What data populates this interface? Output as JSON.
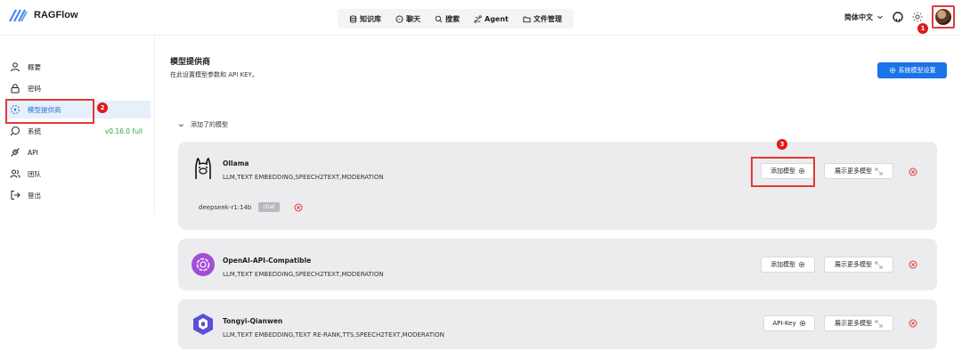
{
  "app": {
    "name": "RAGFlow"
  },
  "nav": [
    {
      "label": "知识库",
      "icon": "database-icon"
    },
    {
      "label": "聊天",
      "icon": "chat-icon"
    },
    {
      "label": "搜索",
      "icon": "search-icon"
    },
    {
      "label": "Agent",
      "icon": "agent-icon"
    },
    {
      "label": "文件管理",
      "icon": "folder-icon"
    }
  ],
  "header": {
    "language": "简体中文"
  },
  "sidebar": {
    "items": [
      {
        "label": "概要",
        "icon": "user-icon"
      },
      {
        "label": "密码",
        "icon": "lock-icon"
      },
      {
        "label": "模型提供商",
        "icon": "model-icon"
      },
      {
        "label": "系统",
        "icon": "system-icon"
      },
      {
        "label": "API",
        "icon": "api-icon"
      },
      {
        "label": "团队",
        "icon": "team-icon"
      },
      {
        "label": "登出",
        "icon": "logout-icon"
      }
    ],
    "version": "v0.16.0 full"
  },
  "main": {
    "title": "模型提供商",
    "subtitle": "在此设置模型参数和 API KEY。",
    "system_settings_button": "系统模型设置",
    "added_section": "添加了的模型"
  },
  "providers": [
    {
      "name": "Ollama",
      "tags": "LLM,TEXT EMBEDDING,SPEECH2TEXT,MODERATION",
      "primary_button": "添加模型",
      "secondary_button": "展示更多模型",
      "models": [
        {
          "name": "deepseek-r1:14b",
          "type": "chat"
        }
      ]
    },
    {
      "name": "OpenAI-API-Compatible",
      "tags": "LLM,TEXT EMBEDDING,SPEECH2TEXT,MODERATION",
      "primary_button": "添加模型",
      "secondary_button": "展示更多模型"
    },
    {
      "name": "Tongyi-Qianwen",
      "tags": "LLM,TEXT EMBEDDING,TEXT RE-RANK,TTS,SPEECH2TEXT,MODERATION",
      "primary_button": "API-Key",
      "secondary_button": "展示更多模型"
    }
  ],
  "annotations": [
    "1",
    "2",
    "3"
  ],
  "colors": {
    "accent": "#1a73e8",
    "highlight": "#e53935",
    "version": "#2aa84a",
    "card": "#ececee"
  }
}
